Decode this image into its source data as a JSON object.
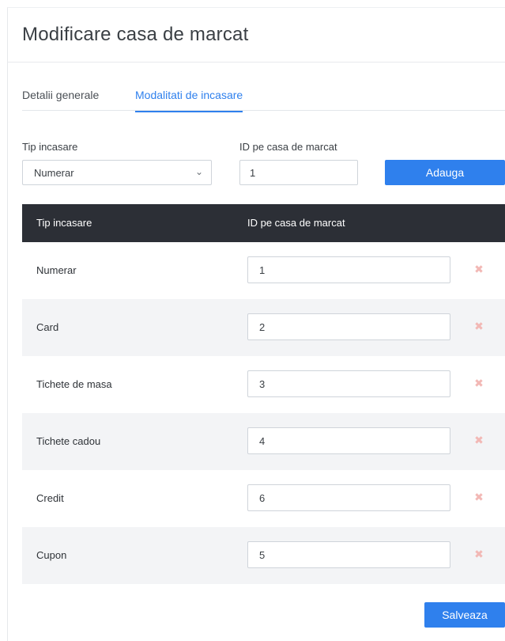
{
  "page": {
    "title": "Modificare casa de marcat"
  },
  "tabs": [
    {
      "label": "Detalii generale",
      "active": false
    },
    {
      "label": "Modalitati de incasare",
      "active": true
    }
  ],
  "form": {
    "tip_label": "Tip incasare",
    "tip_value": "Numerar",
    "id_label": "ID pe casa de marcat",
    "id_value": "1",
    "add_label": "Adauga"
  },
  "table": {
    "headers": [
      "Tip incasare",
      "ID pe casa de marcat"
    ],
    "rows": [
      {
        "name": "Numerar",
        "id": "1"
      },
      {
        "name": "Card",
        "id": "2"
      },
      {
        "name": "Tichete de masa",
        "id": "3"
      },
      {
        "name": "Tichete cadou",
        "id": "4"
      },
      {
        "name": "Credit",
        "id": "6"
      },
      {
        "name": "Cupon",
        "id": "5"
      }
    ]
  },
  "footer": {
    "save_label": "Salveaza"
  },
  "colors": {
    "accent": "#2f80ed",
    "table_header_bg": "#2c2f36",
    "row_alt_bg": "#f3f4f6",
    "delete_icon": "#f2b8b5"
  },
  "icons": {
    "select_chevron": "chevron-down-icon",
    "row_delete": "close-icon"
  }
}
